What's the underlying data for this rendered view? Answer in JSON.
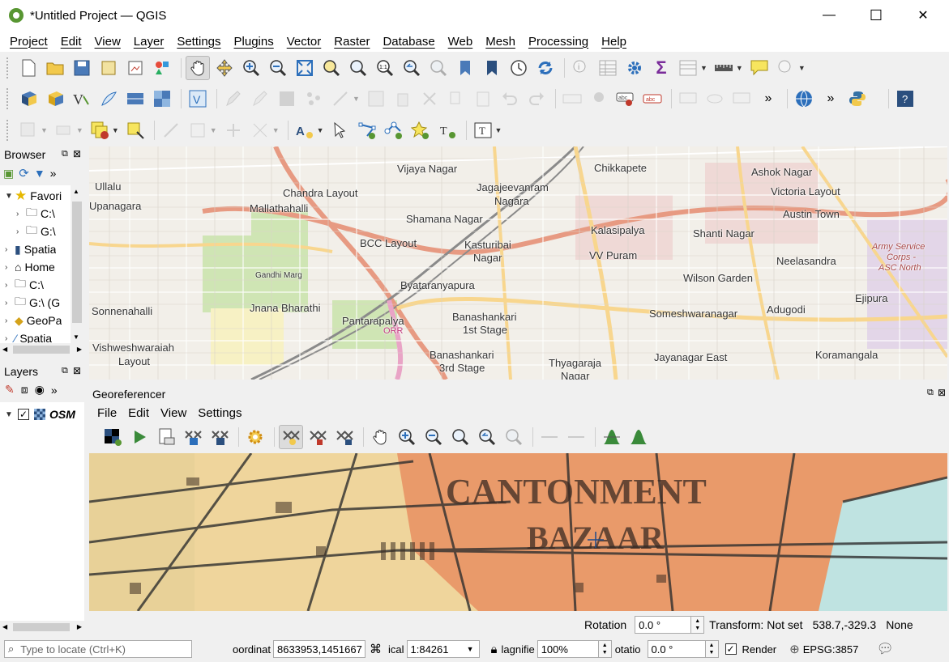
{
  "window": {
    "title": "*Untitled Project — QGIS",
    "minimize": "—",
    "maximize": "☐",
    "close": "✕"
  },
  "menu": [
    "Project",
    "Edit",
    "View",
    "Layer",
    "Settings",
    "Plugins",
    "Vector",
    "Raster",
    "Database",
    "Web",
    "Mesh",
    "Processing",
    "Help"
  ],
  "browser": {
    "title": "Browser",
    "items": [
      {
        "label": "Favori",
        "icon": "star-icon"
      },
      {
        "label": "C:\\",
        "icon": "folder-icon"
      },
      {
        "label": "G:\\",
        "icon": "folder-icon"
      },
      {
        "label": "Spatia",
        "icon": "database-icon"
      },
      {
        "label": "Home",
        "icon": "home-icon"
      },
      {
        "label": "C:\\",
        "icon": "drive-icon"
      },
      {
        "label": "G:\\ (G",
        "icon": "drive-icon"
      },
      {
        "label": "GeoPa",
        "icon": "geopackage-icon"
      },
      {
        "label": "Spatia",
        "icon": "spatialite-icon"
      }
    ]
  },
  "layers": {
    "title": "Layers",
    "items": [
      {
        "label": "OSM",
        "checked": true
      }
    ]
  },
  "map_labels": [
    {
      "text": "Vijaya Nagar"
    },
    {
      "text": "Chikkapete"
    },
    {
      "text": "Ashok Nagar"
    },
    {
      "text": "Ullalu"
    },
    {
      "text": "Jagajeevanram"
    },
    {
      "text": "Nagara"
    },
    {
      "text": "Chandra Layout"
    },
    {
      "text": "Victoria Layout"
    },
    {
      "text": "Upanagara"
    },
    {
      "text": "Mallathahalli"
    },
    {
      "text": "Shamana Nagar"
    },
    {
      "text": "Austin Town"
    },
    {
      "text": "Kalasipalya"
    },
    {
      "text": "Shanti Nagar"
    },
    {
      "text": "BCC Layout"
    },
    {
      "text": "Kasturibai"
    },
    {
      "text": "Nagar"
    },
    {
      "text": "Army Service"
    },
    {
      "text": "Corps -"
    },
    {
      "text": "ASC North"
    },
    {
      "text": "VV Puram"
    },
    {
      "text": "Neelasandra"
    },
    {
      "text": "Wilson Garden"
    },
    {
      "text": "Byataranyapura"
    },
    {
      "text": "Jnana Bharathi"
    },
    {
      "text": "Sonnenahalli"
    },
    {
      "text": "Adugodi"
    },
    {
      "text": "Ejipura"
    },
    {
      "text": "Someshwaranagar"
    },
    {
      "text": "Pantarapalya"
    },
    {
      "text": "Banashankari"
    },
    {
      "text": "1st Stage"
    },
    {
      "text": "Vishweshwaraiah"
    },
    {
      "text": "Layout"
    },
    {
      "text": "Banashankari"
    },
    {
      "text": "3rd Stage"
    },
    {
      "text": "Thyagaraja"
    },
    {
      "text": "Nagar"
    },
    {
      "text": "Jayanagar East"
    },
    {
      "text": "Koramangala"
    },
    {
      "text": "ORR"
    },
    {
      "text": "Gandhi Marg"
    }
  ],
  "georeferencer": {
    "title": "Georeferencer",
    "menu": [
      "File",
      "Edit",
      "View",
      "Settings"
    ],
    "image_text": [
      "CANTONMENT",
      "BAZAAR"
    ],
    "rotation_label": "Rotation",
    "rotation_value": "0.0 °",
    "transform": "Transform: Not set",
    "coords": "538.7,-329.3",
    "none": "None"
  },
  "status": {
    "locate_placeholder": "Type to locate (Ctrl+K)",
    "coordinate_label": "oordinat",
    "coordinate_value": "8633953,1451667",
    "scale_label": "ical",
    "scale_value": "1:84261",
    "magnifier_label": "lagnifie",
    "magnifier_value": "100%",
    "rotation_label": "otatio",
    "rotation_value": "0.0 °",
    "render_label": "Render",
    "crs": "EPSG:3857"
  }
}
